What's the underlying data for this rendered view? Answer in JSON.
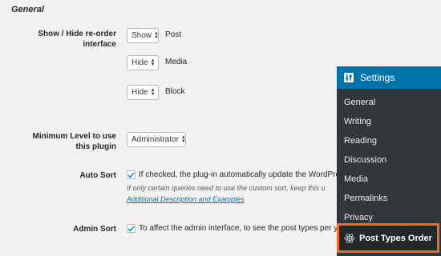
{
  "section": {
    "title": "General"
  },
  "show_hide": {
    "label": "Show / Hide re-order interface",
    "rows": [
      {
        "value": "Show",
        "name": "Post"
      },
      {
        "value": "Hide",
        "name": "Media"
      },
      {
        "value": "Hide",
        "name": "Block"
      }
    ]
  },
  "minimum_level": {
    "label": "Minimum Level to use this plugin",
    "value": "Administrator"
  },
  "auto_sort": {
    "label": "Auto Sort",
    "checked": true,
    "description": "If checked, the plug-in automatically update the WordPress",
    "hint": "If only certain queries need to use the custom sort, keep this u",
    "link": "Additional Description and Examples"
  },
  "admin_sort": {
    "label": "Admin Sort",
    "checked": true,
    "description": "To affect the admin interface, to see the post types per you"
  },
  "settings_menu": {
    "title": "Settings",
    "items": [
      "General",
      "Writing",
      "Reading",
      "Discussion",
      "Media",
      "Permalinks",
      "Privacy"
    ],
    "highlighted": "Post Types Order",
    "accent_color": "#f06b2a",
    "header_color": "#0073aa",
    "menu_bg": "#32373c"
  }
}
